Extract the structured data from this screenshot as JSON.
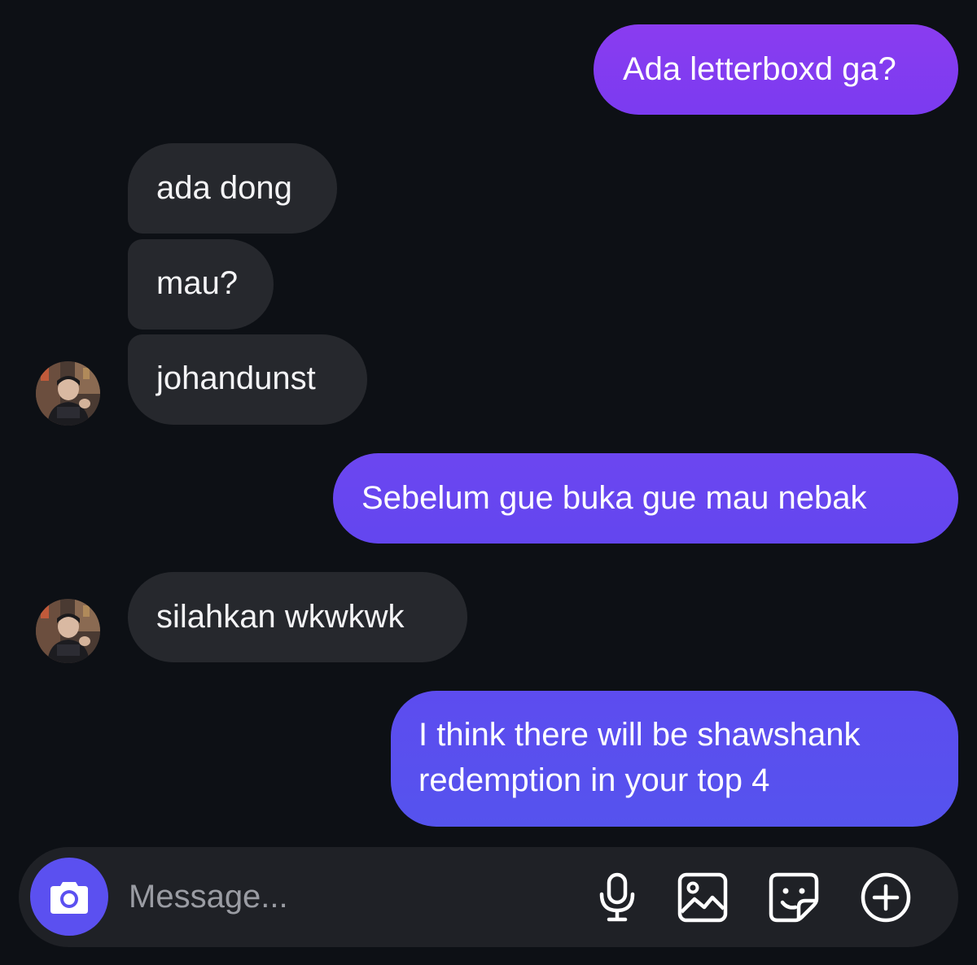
{
  "thread": {
    "messages": [
      {
        "direction": "outgoing",
        "text": "Ada letterboxd ga?"
      },
      {
        "direction": "incoming",
        "text": "ada dong"
      },
      {
        "direction": "incoming",
        "text": "mau?"
      },
      {
        "direction": "incoming",
        "text": "johandunst"
      },
      {
        "direction": "outgoing",
        "text": "Sebelum gue buka gue mau nebak"
      },
      {
        "direction": "incoming",
        "text": "silahkan wkwkwk"
      },
      {
        "direction": "outgoing",
        "lines": [
          "I think there will be shawshank",
          "redemption in your top 4"
        ]
      }
    ]
  },
  "composer": {
    "placeholder": "Message...",
    "buttons": [
      "camera-icon",
      "microphone-icon",
      "gallery-icon",
      "sticker-icon",
      "plus-circle-icon"
    ]
  },
  "colors": {
    "background": "#0d1015",
    "incoming_bubble": "#26282d",
    "outgoing_bubble_top": "#8a3cf0",
    "outgoing_bubble_bottom": "#5553ee",
    "camera_button": "#5b50f0",
    "composer_background": "#1f2126"
  }
}
